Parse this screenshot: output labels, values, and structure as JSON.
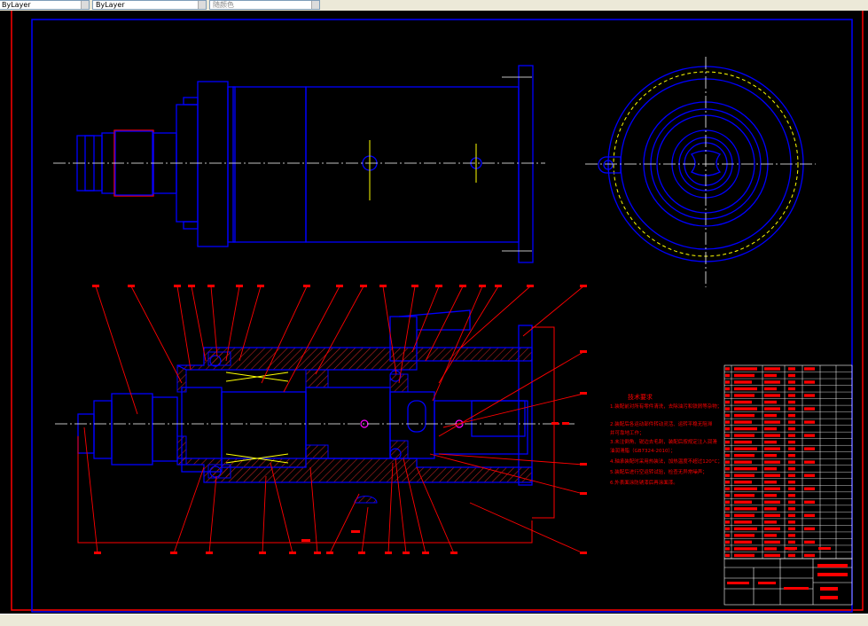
{
  "toolbar": {
    "layer_combo": "ByLayer",
    "linetype_combo": "ByLayer",
    "color_combo": "随颜色"
  },
  "colors": {
    "background": "#000000",
    "border": "#ff0000",
    "outline": "#0000ff",
    "centerline": "#ffffff",
    "hatch": "#8b0000",
    "leader": "#ff0000",
    "annotation": "#ff0000",
    "highlight": "#ffff00"
  },
  "drawing": {
    "notes_title": "技术要求",
    "notes_lines": [
      "1.装配前对所有零件清洗，去除油污和铁屑等杂物；",
      "2.装配后各运动部件转动灵活、运转平稳无阻滞",
      "并可靠地工作；",
      "3.未注倒角、锐边去毛刺，装配后按规定注入润滑",
      "油润滑脂（GB7324-2010）；",
      "4.轴承装配时采用热装法，加热温度不超过120°C；",
      "5.装配后进行空运转试验，检查无异常噪声；",
      "6.外表面涂防锈漆后再涂面漆。"
    ]
  }
}
